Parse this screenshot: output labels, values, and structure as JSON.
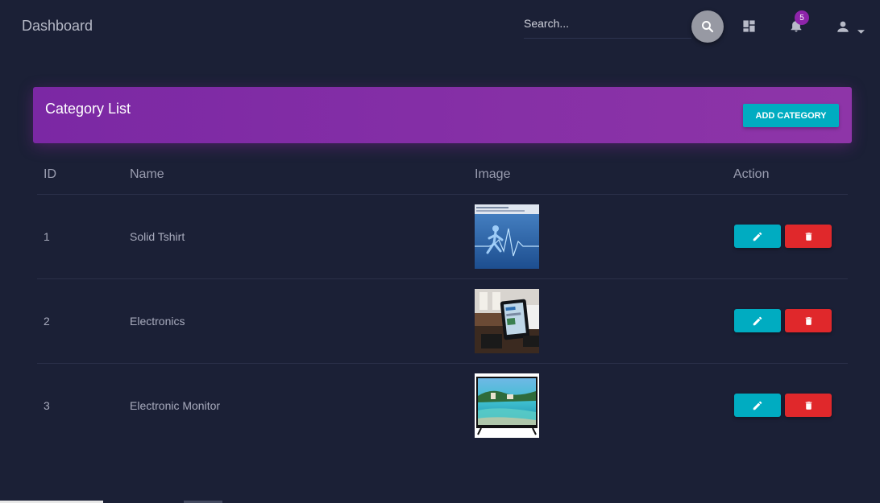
{
  "navbar": {
    "brand": "Dashboard",
    "search_placeholder": "Search...",
    "notification_count": "5",
    "icons": [
      "search-icon",
      "dashboard-icon",
      "bell-icon",
      "user-icon",
      "caret-down-icon"
    ]
  },
  "card": {
    "title": "Category List",
    "add_button_label": "ADD CATEGORY"
  },
  "table": {
    "headers": [
      "ID",
      "Name",
      "Image",
      "Action"
    ],
    "rows": [
      {
        "id": "1",
        "name": "Solid Tshirt",
        "image": "fitness-runner-thumbnail"
      },
      {
        "id": "2",
        "name": "Electronics",
        "image": "tablet-in-room-thumbnail"
      },
      {
        "id": "3",
        "name": "Electronic Monitor",
        "image": "tv-monitor-thumbnail"
      }
    ],
    "actions": [
      "edit-icon",
      "delete-icon"
    ]
  },
  "colors": {
    "background": "#1b2036",
    "header_gradient_start": "#7b28a4",
    "header_gradient_end": "#8e35a8",
    "edit": "#00acc1",
    "delete": "#e0282b",
    "badge": "#8e24aa"
  }
}
